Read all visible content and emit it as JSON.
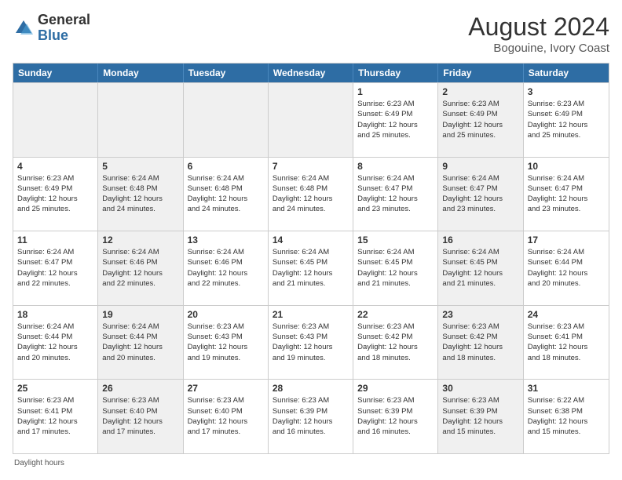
{
  "header": {
    "logo_line1": "General",
    "logo_line2": "Blue",
    "main_title": "August 2024",
    "subtitle": "Bogouine, Ivory Coast"
  },
  "days_of_week": [
    "Sunday",
    "Monday",
    "Tuesday",
    "Wednesday",
    "Thursday",
    "Friday",
    "Saturday"
  ],
  "weeks": [
    [
      {
        "day": "",
        "info": "",
        "shaded": true
      },
      {
        "day": "",
        "info": "",
        "shaded": true
      },
      {
        "day": "",
        "info": "",
        "shaded": true
      },
      {
        "day": "",
        "info": "",
        "shaded": true
      },
      {
        "day": "1",
        "info": "Sunrise: 6:23 AM\nSunset: 6:49 PM\nDaylight: 12 hours\nand 25 minutes.",
        "shaded": false
      },
      {
        "day": "2",
        "info": "Sunrise: 6:23 AM\nSunset: 6:49 PM\nDaylight: 12 hours\nand 25 minutes.",
        "shaded": true
      },
      {
        "day": "3",
        "info": "Sunrise: 6:23 AM\nSunset: 6:49 PM\nDaylight: 12 hours\nand 25 minutes.",
        "shaded": false
      }
    ],
    [
      {
        "day": "4",
        "info": "Sunrise: 6:23 AM\nSunset: 6:49 PM\nDaylight: 12 hours\nand 25 minutes.",
        "shaded": false
      },
      {
        "day": "5",
        "info": "Sunrise: 6:24 AM\nSunset: 6:48 PM\nDaylight: 12 hours\nand 24 minutes.",
        "shaded": true
      },
      {
        "day": "6",
        "info": "Sunrise: 6:24 AM\nSunset: 6:48 PM\nDaylight: 12 hours\nand 24 minutes.",
        "shaded": false
      },
      {
        "day": "7",
        "info": "Sunrise: 6:24 AM\nSunset: 6:48 PM\nDaylight: 12 hours\nand 24 minutes.",
        "shaded": false
      },
      {
        "day": "8",
        "info": "Sunrise: 6:24 AM\nSunset: 6:47 PM\nDaylight: 12 hours\nand 23 minutes.",
        "shaded": false
      },
      {
        "day": "9",
        "info": "Sunrise: 6:24 AM\nSunset: 6:47 PM\nDaylight: 12 hours\nand 23 minutes.",
        "shaded": true
      },
      {
        "day": "10",
        "info": "Sunrise: 6:24 AM\nSunset: 6:47 PM\nDaylight: 12 hours\nand 23 minutes.",
        "shaded": false
      }
    ],
    [
      {
        "day": "11",
        "info": "Sunrise: 6:24 AM\nSunset: 6:47 PM\nDaylight: 12 hours\nand 22 minutes.",
        "shaded": false
      },
      {
        "day": "12",
        "info": "Sunrise: 6:24 AM\nSunset: 6:46 PM\nDaylight: 12 hours\nand 22 minutes.",
        "shaded": true
      },
      {
        "day": "13",
        "info": "Sunrise: 6:24 AM\nSunset: 6:46 PM\nDaylight: 12 hours\nand 22 minutes.",
        "shaded": false
      },
      {
        "day": "14",
        "info": "Sunrise: 6:24 AM\nSunset: 6:45 PM\nDaylight: 12 hours\nand 21 minutes.",
        "shaded": false
      },
      {
        "day": "15",
        "info": "Sunrise: 6:24 AM\nSunset: 6:45 PM\nDaylight: 12 hours\nand 21 minutes.",
        "shaded": false
      },
      {
        "day": "16",
        "info": "Sunrise: 6:24 AM\nSunset: 6:45 PM\nDaylight: 12 hours\nand 21 minutes.",
        "shaded": true
      },
      {
        "day": "17",
        "info": "Sunrise: 6:24 AM\nSunset: 6:44 PM\nDaylight: 12 hours\nand 20 minutes.",
        "shaded": false
      }
    ],
    [
      {
        "day": "18",
        "info": "Sunrise: 6:24 AM\nSunset: 6:44 PM\nDaylight: 12 hours\nand 20 minutes.",
        "shaded": false
      },
      {
        "day": "19",
        "info": "Sunrise: 6:24 AM\nSunset: 6:44 PM\nDaylight: 12 hours\nand 20 minutes.",
        "shaded": true
      },
      {
        "day": "20",
        "info": "Sunrise: 6:23 AM\nSunset: 6:43 PM\nDaylight: 12 hours\nand 19 minutes.",
        "shaded": false
      },
      {
        "day": "21",
        "info": "Sunrise: 6:23 AM\nSunset: 6:43 PM\nDaylight: 12 hours\nand 19 minutes.",
        "shaded": false
      },
      {
        "day": "22",
        "info": "Sunrise: 6:23 AM\nSunset: 6:42 PM\nDaylight: 12 hours\nand 18 minutes.",
        "shaded": false
      },
      {
        "day": "23",
        "info": "Sunrise: 6:23 AM\nSunset: 6:42 PM\nDaylight: 12 hours\nand 18 minutes.",
        "shaded": true
      },
      {
        "day": "24",
        "info": "Sunrise: 6:23 AM\nSunset: 6:41 PM\nDaylight: 12 hours\nand 18 minutes.",
        "shaded": false
      }
    ],
    [
      {
        "day": "25",
        "info": "Sunrise: 6:23 AM\nSunset: 6:41 PM\nDaylight: 12 hours\nand 17 minutes.",
        "shaded": false
      },
      {
        "day": "26",
        "info": "Sunrise: 6:23 AM\nSunset: 6:40 PM\nDaylight: 12 hours\nand 17 minutes.",
        "shaded": true
      },
      {
        "day": "27",
        "info": "Sunrise: 6:23 AM\nSunset: 6:40 PM\nDaylight: 12 hours\nand 17 minutes.",
        "shaded": false
      },
      {
        "day": "28",
        "info": "Sunrise: 6:23 AM\nSunset: 6:39 PM\nDaylight: 12 hours\nand 16 minutes.",
        "shaded": false
      },
      {
        "day": "29",
        "info": "Sunrise: 6:23 AM\nSunset: 6:39 PM\nDaylight: 12 hours\nand 16 minutes.",
        "shaded": false
      },
      {
        "day": "30",
        "info": "Sunrise: 6:23 AM\nSunset: 6:39 PM\nDaylight: 12 hours\nand 15 minutes.",
        "shaded": true
      },
      {
        "day": "31",
        "info": "Sunrise: 6:22 AM\nSunset: 6:38 PM\nDaylight: 12 hours\nand 15 minutes.",
        "shaded": false
      }
    ]
  ],
  "footer": "Daylight hours"
}
